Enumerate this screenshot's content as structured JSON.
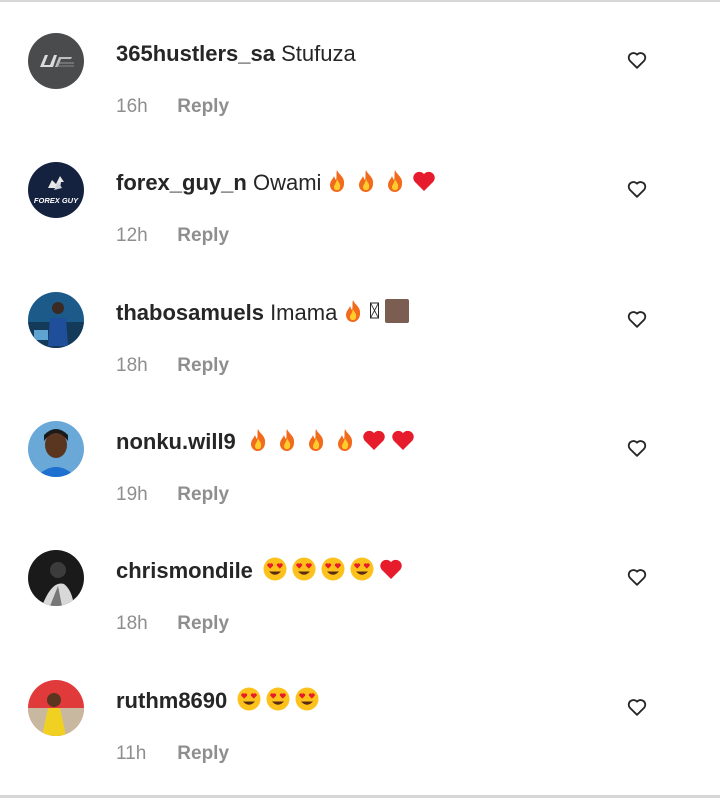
{
  "comments": [
    {
      "username": "365hustlers_sa",
      "text": "Stufuza",
      "emojis": [],
      "time": "16h",
      "reply": "Reply",
      "avatar": "logo-dark-gray"
    },
    {
      "username": "forex_guy_n",
      "text": "Owami",
      "emojis": [
        "fire",
        "fire",
        "fire",
        "red-heart"
      ],
      "time": "12h",
      "reply": "Reply",
      "avatar": "forex-guy-logo",
      "avatar_text": "FOREX GUY"
    },
    {
      "username": "thabosamuels",
      "text": "Imama",
      "emojis": [
        "fire",
        "missing-glyph",
        "brown-square"
      ],
      "time": "18h",
      "reply": "Reply",
      "avatar": "photo-blue"
    },
    {
      "username": "nonku.will9",
      "text": "",
      "emojis": [
        "fire",
        "fire",
        "fire",
        "fire",
        "red-heart",
        "red-heart"
      ],
      "time": "19h",
      "reply": "Reply",
      "avatar": "photo-woman-blue"
    },
    {
      "username": "chrismondile",
      "text": "",
      "emojis": [
        "heart-eyes",
        "heart-eyes",
        "heart-eyes",
        "heart-eyes",
        "red-heart"
      ],
      "time": "18h",
      "reply": "Reply",
      "avatar": "photo-bw"
    },
    {
      "username": "ruthm8690",
      "text": "",
      "emojis": [
        "heart-eyes",
        "heart-eyes",
        "heart-eyes"
      ],
      "time": "11h",
      "reply": "Reply",
      "avatar": "photo-red-yellow"
    }
  ],
  "colors": {
    "text": "#262626",
    "meta": "#8e8e8e",
    "border": "#d6d6d6"
  }
}
